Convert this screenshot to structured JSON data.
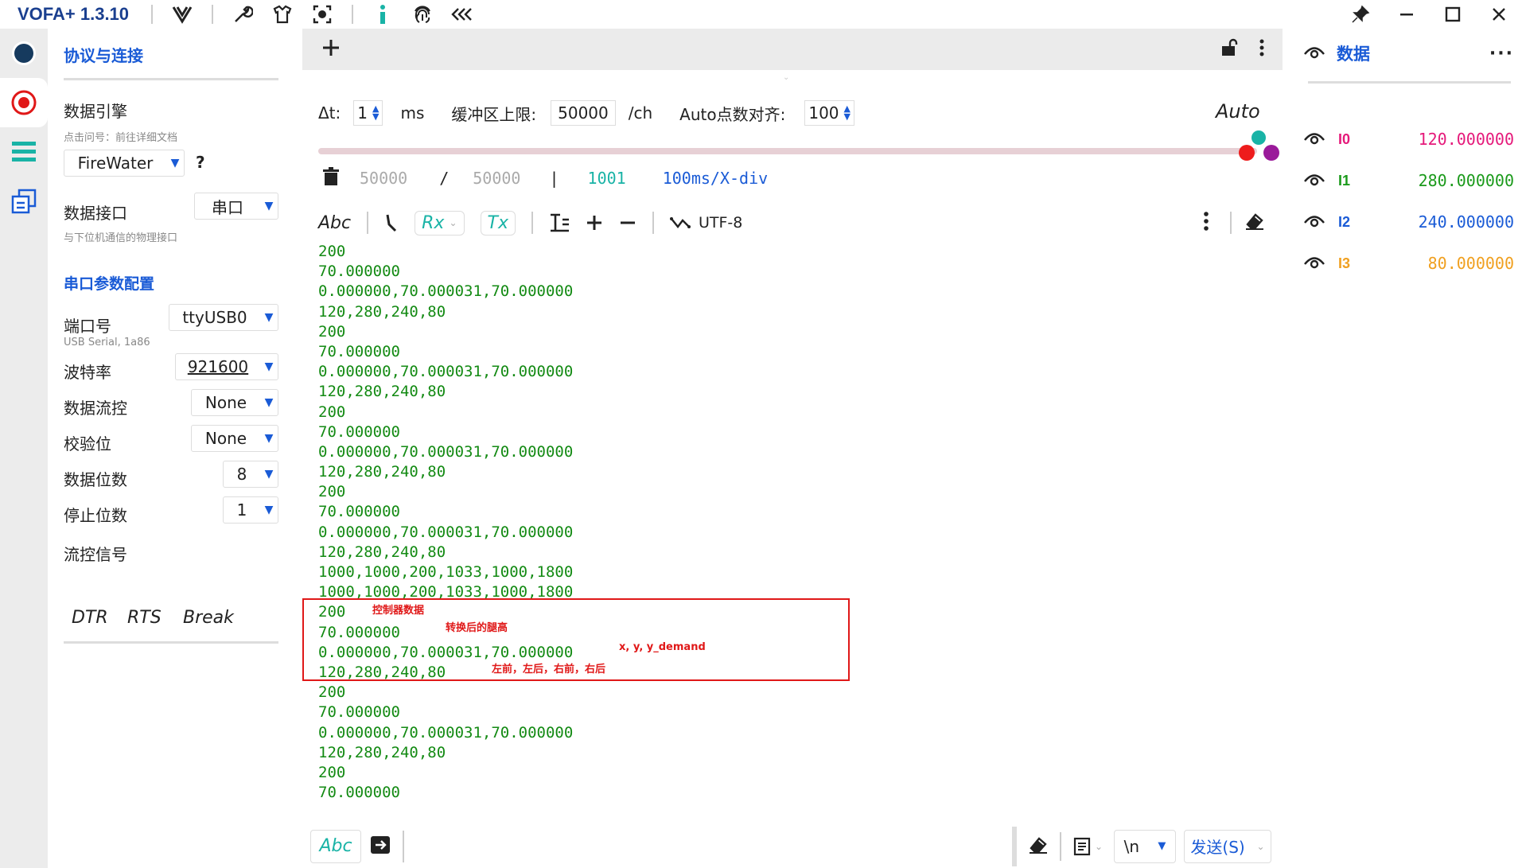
{
  "app": {
    "title": "VOFA+ 1.3.10"
  },
  "config": {
    "protocol_title": "协议与连接",
    "engine_label": "数据引擎",
    "engine_hint": "点击问号：前往详细文档",
    "engine_value": "FireWater",
    "help_mark": "?",
    "interface_label": "数据接口",
    "interface_value": "串口",
    "interface_hint": "与下位机通信的物理接口",
    "serial_title": "串口参数配置",
    "port_label": "端口号",
    "port_value": "ttyUSB0",
    "port_hint": "USB Serial, 1a86",
    "baud_label": "波特率",
    "baud_value": "921600",
    "flow_label": "数据流控",
    "flow_value": "None",
    "parity_label": "校验位",
    "parity_value": "None",
    "databits_label": "数据位数",
    "databits_value": "8",
    "stopbits_label": "停止位数",
    "stopbits_value": "1",
    "signal_label": "流控信号",
    "dtr": "DTR",
    "rts": "RTS",
    "brk": "Break"
  },
  "controls": {
    "dt_label": "Δt:",
    "dt_value": "1",
    "dt_unit": "ms",
    "buffer_label": "缓冲区上限:",
    "buffer_value": "50000",
    "buffer_unit": "/ch",
    "align_label": "Auto点数对齐:",
    "align_value": "100",
    "auto": "Auto"
  },
  "stats": {
    "count": "50000",
    "slash": "/",
    "limit": "50000",
    "bar": "|",
    "points": "1001",
    "division": "100ms/X-div"
  },
  "toolbar": {
    "abc": "Abc",
    "rx": "Rx",
    "tx": "Tx",
    "encoding": "UTF-8"
  },
  "console_lines": [
    "200",
    "70.000000",
    "0.000000,70.000031,70.000000",
    "120,280,240,80",
    "200",
    "70.000000",
    "0.000000,70.000031,70.000000",
    "120,280,240,80",
    "200",
    "70.000000",
    "0.000000,70.000031,70.000000",
    "120,280,240,80",
    "200",
    "70.000000",
    "0.000000,70.000031,70.000000",
    "120,280,240,80",
    "1000,1000,200,1033,1000,1800",
    "1000,1000,200,1033,1000,1800",
    "200",
    "70.000000",
    "0.000000,70.000031,70.000000",
    "120,280,240,80",
    "200",
    "70.000000",
    "0.000000,70.000031,70.000000",
    "120,280,240,80",
    "200",
    "70.000000"
  ],
  "annotations": {
    "controller": "控制器数据",
    "leg_height": "转换后的腿高",
    "xy": "x, y, y_demand",
    "legs": "左前，左后，右前，右后"
  },
  "bottom": {
    "abc": "Abc",
    "newline": "\\n",
    "send": "发送(S)"
  },
  "data_panel": {
    "title": "数据",
    "channels": [
      {
        "name": "I0",
        "value": "120.000000",
        "color": "#e5197a"
      },
      {
        "name": "I1",
        "value": "280.000000",
        "color": "#1b9a1b"
      },
      {
        "name": "I2",
        "value": "240.000000",
        "color": "#1a5bd6"
      },
      {
        "name": "I3",
        "value": "80.000000",
        "color": "#f0a020"
      }
    ]
  },
  "colors": {
    "accent": "#1a5bd6",
    "console": "#138a13",
    "annotation": "#e01818"
  }
}
